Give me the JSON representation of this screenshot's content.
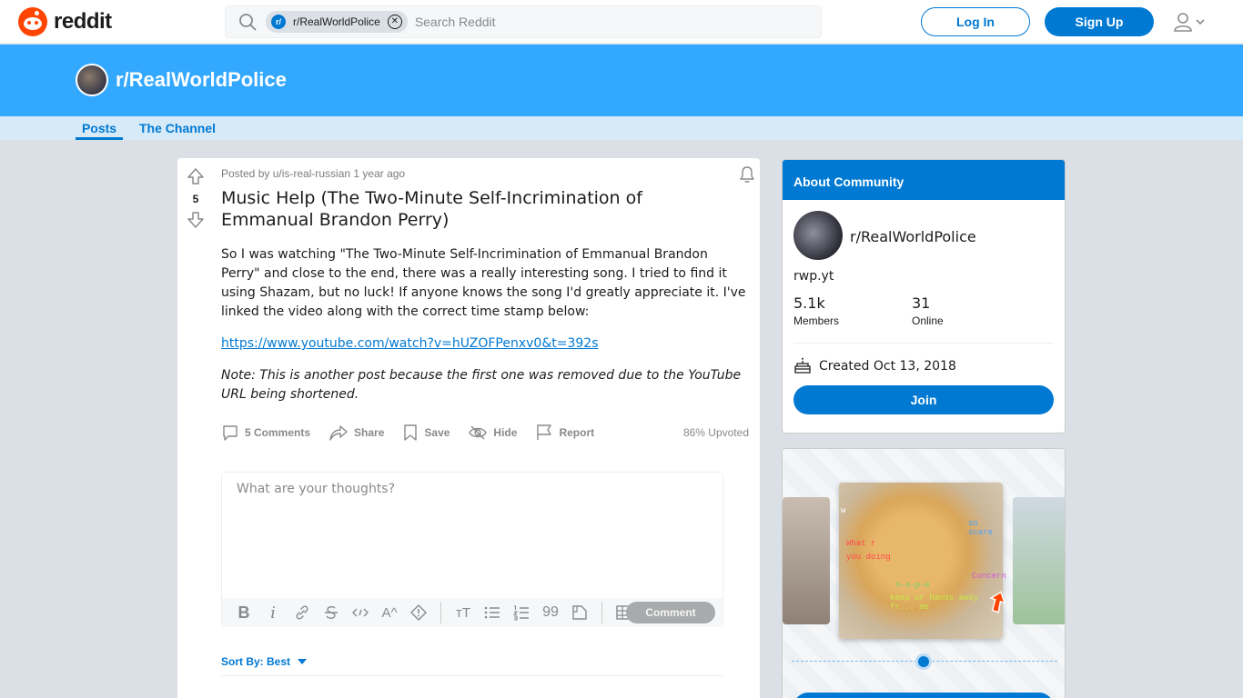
{
  "header": {
    "logo_text": "reddit",
    "search": {
      "chip_icon": "r/",
      "chip_label": "r/RealWorldPolice",
      "placeholder": "Search Reddit"
    },
    "login_label": "Log In",
    "signup_label": "Sign Up"
  },
  "banner": {
    "title": "r/RealWorldPolice"
  },
  "tabs": [
    {
      "label": "Posts"
    },
    {
      "label": "The Channel"
    }
  ],
  "post": {
    "score": "5",
    "meta": "Posted by u/is-real-russian 1 year ago",
    "title": "Music Help (The Two-Minute Self-Incrimination of Emmanual Brandon Perry)",
    "body": "So I was watching \"The Two-Minute Self-Incrimination of Emmanual Brandon Perry\" and close to the end, there was a really interesting song. I tried to find it using Shazam, but no luck! If anyone knows the song I'd greatly appreciate it. I've linked the video along with the correct time stamp below:",
    "link": "https://www.youtube.com/watch?v=hUZOFPenxv0&t=392s",
    "note": "Note: This is another post because the first one was removed due to the YouTube URL being shortened.",
    "actions": {
      "comments": "5 Comments",
      "share": "Share",
      "save": "Save",
      "hide": "Hide",
      "report": "Report"
    },
    "upvoted": "86% Upvoted"
  },
  "comment_box": {
    "placeholder": "What are your thoughts?",
    "toolbar": {
      "bold": "B",
      "italic": "i",
      "superscript": "A^",
      "heading": "тT",
      "quote": "99"
    },
    "submit_label": "Comment"
  },
  "sort": {
    "label": "Sort By: Best"
  },
  "about": {
    "heading": "About Community",
    "name": "r/RealWorldPolice",
    "description": "rwp.yt",
    "members_value": "5.1k",
    "members_label": "Members",
    "online_value": "31",
    "online_label": "Online",
    "created": "Created Oct 13, 2018",
    "join_label": "Join"
  },
  "promo": {
    "captions": [
      "w",
      "so scare",
      "What r",
      "you doing",
      "Concern",
      "n-o-p-e",
      "keep ur hands away fr... me"
    ]
  },
  "colors": {
    "brand": "#ff4500",
    "accent": "#0079d3",
    "banner": "#33a8ff",
    "tabs_bg": "#d6eaf8",
    "page_bg": "#dae0e6"
  }
}
